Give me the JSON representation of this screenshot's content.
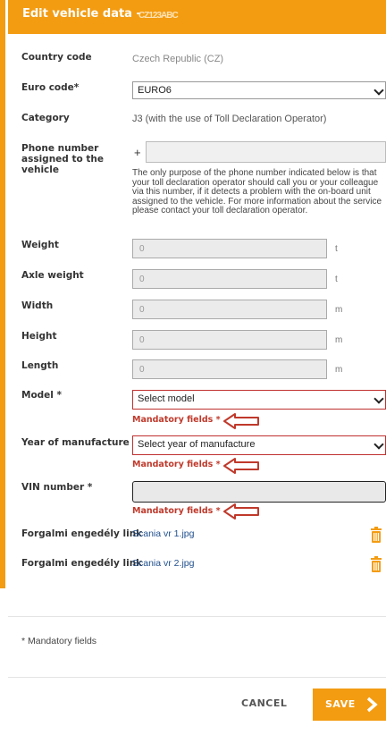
{
  "header": {
    "title": "Edit vehicle data -",
    "plate_obscured": "CZ123ABC"
  },
  "fields": {
    "country_code": {
      "label": "Country code",
      "value": "Czech Republic (CZ)"
    },
    "euro_code": {
      "label": "Euro code*",
      "value": "EURO6"
    },
    "category": {
      "label": "Category",
      "value": "J3 (with the use of Toll Declaration Operator)"
    },
    "phone": {
      "label": "Phone number assigned to the vehicle",
      "prefix": "+",
      "value": "",
      "info": "The only purpose of the phone number indicated below is that your toll declaration operator should call you or your colleague via this number, if it detects a problem with the on-board unit assigned to the vehicle. For more information about the service please contact your toll declaration operator."
    },
    "weight": {
      "label": "Weight",
      "value": "0",
      "unit": "t"
    },
    "axle_weight": {
      "label": "Axle weight",
      "value": "0",
      "unit": "t"
    },
    "width": {
      "label": "Width",
      "value": "0",
      "unit": "m"
    },
    "height": {
      "label": "Height",
      "value": "0",
      "unit": "m"
    },
    "length": {
      "label": "Length",
      "value": "0",
      "unit": "m"
    },
    "model": {
      "label": "Model *",
      "value": "Select model",
      "error": "Mandatory fields *"
    },
    "year": {
      "label": "Year of manufacture *",
      "value": "Select year of manufacture",
      "error": "Mandatory fields *"
    },
    "vin": {
      "label": "VIN number *",
      "value": "",
      "error": "Mandatory fields *"
    },
    "link1": {
      "label": "Forgalmi engedély link",
      "file": "Scania vr 1.jpg"
    },
    "link2": {
      "label": "Forgalmi engedély link",
      "file": "Scania vr 2.jpg"
    }
  },
  "footer": {
    "note": "* Mandatory fields",
    "cancel": "CANCEL",
    "save": "SAVE"
  },
  "colors": {
    "accent": "#f39c12",
    "error": "#c0392b",
    "link": "#1f4e8c"
  },
  "icons": {
    "arrow": "left-arrow-outline-icon",
    "trash": "trash-icon",
    "save": "chevron-right-icon"
  }
}
